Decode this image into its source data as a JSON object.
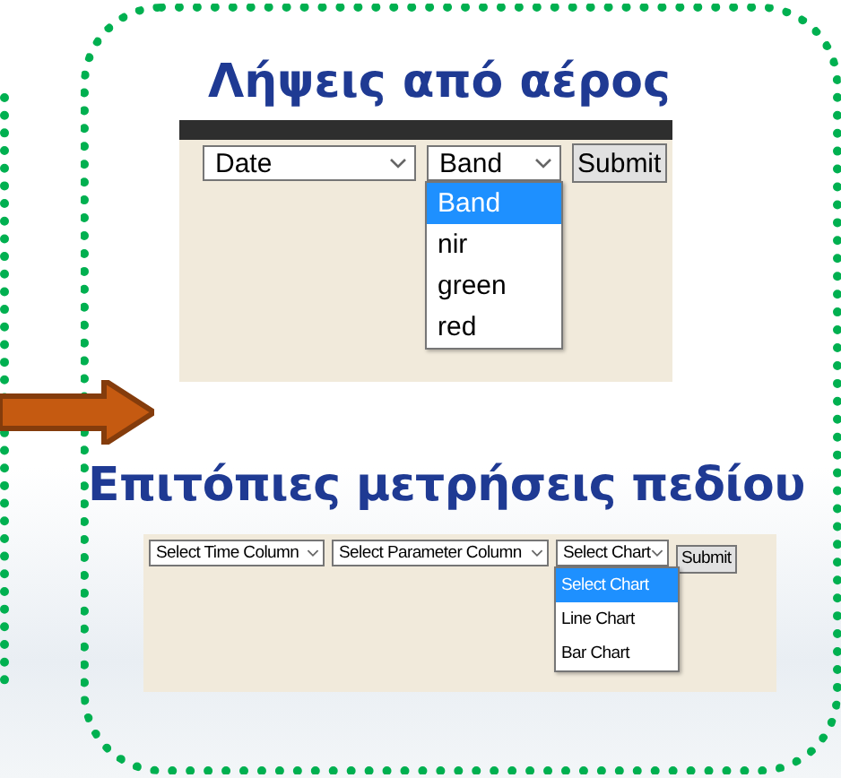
{
  "panels": [
    {
      "title": "Λήψεις από αέρος",
      "kind": "large",
      "controls": [
        {
          "kind": "select",
          "value": "Date"
        },
        {
          "kind": "select",
          "value": "Band",
          "options": [
            {
              "label": "Band",
              "selected": true
            },
            {
              "label": "nir",
              "selected": false
            },
            {
              "label": "green",
              "selected": false
            },
            {
              "label": "red",
              "selected": false
            }
          ]
        },
        {
          "kind": "button",
          "label": "Submit"
        }
      ]
    },
    {
      "title": "Επιτόπιες μετρήσεις πεδίου",
      "kind": "small",
      "controls": [
        {
          "kind": "select",
          "value": "Select Time Column"
        },
        {
          "kind": "select",
          "value": "Select Parameter Column"
        },
        {
          "kind": "select",
          "value": "Select Chart",
          "options": [
            {
              "label": "Select Chart",
              "selected": true
            },
            {
              "label": "Line Chart",
              "selected": false
            },
            {
              "label": "Bar Chart",
              "selected": false
            }
          ]
        },
        {
          "kind": "button",
          "label": "Submit"
        }
      ]
    }
  ]
}
